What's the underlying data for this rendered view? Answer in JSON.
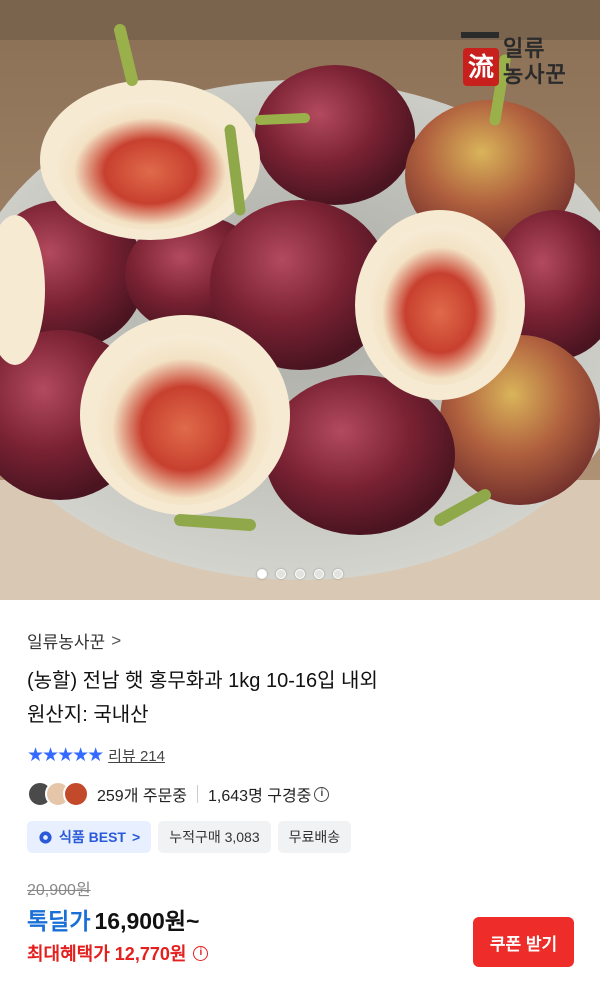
{
  "brand": {
    "logo_text_line1": "일류",
    "logo_text_line2": "농사꾼",
    "seal_glyph": "流"
  },
  "carousel": {
    "count": 5,
    "active_index": 0
  },
  "seller": {
    "name": "일류농사꾼",
    "chevron": ">"
  },
  "product": {
    "title_line1": "(농할) 전남 햇 홍무화과 1kg 10-16입 내외",
    "title_line2": "원산지: 국내산"
  },
  "rating": {
    "stars": "★★★★★",
    "stars_value": 5,
    "review_label": "리뷰 214"
  },
  "buyers": {
    "ordering_text": "259개 주문중",
    "considering_text": "1,643명 구경중",
    "info_glyph": "i"
  },
  "badges": {
    "food_label": "식품 BEST",
    "food_chevron": ">",
    "cumulative": "누적구매 3,083",
    "shipping": "무료배송"
  },
  "price": {
    "original": "20,900원",
    "deal_label": "톡딜가",
    "deal_value": "16,900원~",
    "max_benefit": "최대혜택가 12,770원",
    "info_glyph": "i"
  },
  "coupon_button": {
    "label": "쿠폰 받기",
    "color": "#ee2d2a"
  },
  "colors": {
    "accent_blue": "#346aff",
    "deal_blue": "#1a6fd6",
    "sale_red": "#e4201f"
  }
}
